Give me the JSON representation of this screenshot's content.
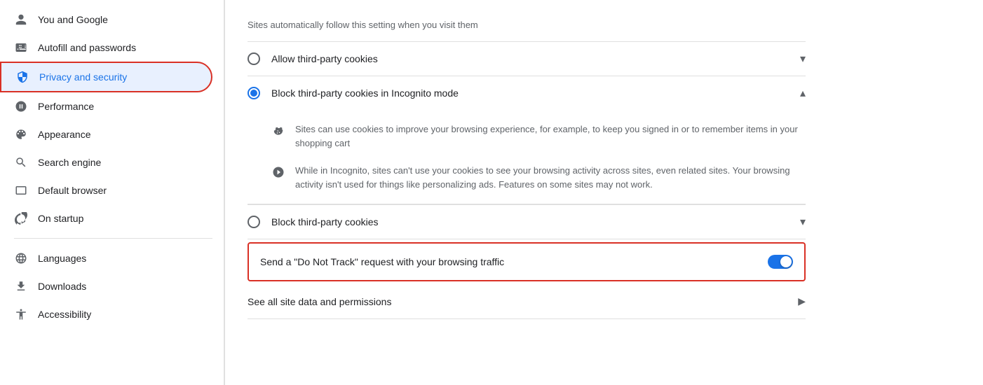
{
  "sidebar": {
    "items": [
      {
        "id": "you-and-google",
        "label": "You and Google",
        "icon": "person",
        "active": false
      },
      {
        "id": "autofill-and-passwords",
        "label": "Autofill and passwords",
        "icon": "autofill",
        "active": false
      },
      {
        "id": "privacy-and-security",
        "label": "Privacy and security",
        "icon": "shield",
        "active": true
      },
      {
        "id": "performance",
        "label": "Performance",
        "icon": "performance",
        "active": false
      },
      {
        "id": "appearance",
        "label": "Appearance",
        "icon": "palette",
        "active": false
      },
      {
        "id": "search-engine",
        "label": "Search engine",
        "icon": "search",
        "active": false
      },
      {
        "id": "default-browser",
        "label": "Default browser",
        "icon": "browser",
        "active": false
      },
      {
        "id": "on-startup",
        "label": "On startup",
        "icon": "startup",
        "active": false
      },
      {
        "id": "languages",
        "label": "Languages",
        "icon": "globe",
        "active": false
      },
      {
        "id": "downloads",
        "label": "Downloads",
        "icon": "download",
        "active": false
      },
      {
        "id": "accessibility",
        "label": "Accessibility",
        "icon": "accessibility",
        "active": false
      }
    ]
  },
  "main": {
    "top_description": "Sites automatically follow this setting when you visit them",
    "cookie_options": [
      {
        "id": "allow-third-party",
        "label": "Allow third-party cookies",
        "selected": false,
        "expanded": false,
        "chevron": "▾"
      },
      {
        "id": "block-incognito",
        "label": "Block third-party cookies in Incognito mode",
        "selected": true,
        "expanded": true,
        "chevron": "▴"
      },
      {
        "id": "block-all",
        "label": "Block third-party cookies",
        "selected": false,
        "expanded": false,
        "chevron": "▾"
      }
    ],
    "expanded_rows": [
      {
        "icon": "cookie",
        "text": "Sites can use cookies to improve your browsing experience, for example, to keep you signed in or to remember items in your shopping cart"
      },
      {
        "icon": "block",
        "text": "While in Incognito, sites can't use your cookies to see your browsing activity across sites, even related sites. Your browsing activity isn't used for things like personalizing ads. Features on some sites may not work."
      }
    ],
    "dnt_label": "Send a \"Do Not Track\" request with your browsing traffic",
    "dnt_enabled": true,
    "site_data_label": "See all site data and permissions"
  }
}
